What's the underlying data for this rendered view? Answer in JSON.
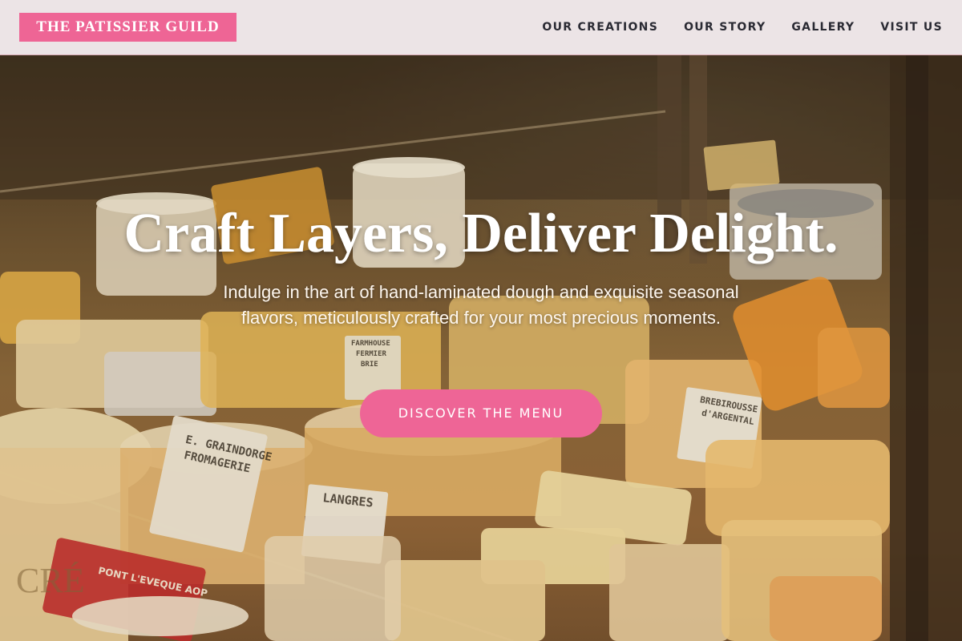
{
  "header": {
    "brand": "THE PATISSIER GUILD",
    "nav": [
      {
        "label": "OUR CREATIONS"
      },
      {
        "label": "OUR STORY"
      },
      {
        "label": "GALLERY"
      },
      {
        "label": "VISIT US"
      }
    ]
  },
  "hero": {
    "title": "Craft Layers, Deliver Delight.",
    "subtitle": "Indulge in the art of hand-laminated dough and exquisite seasonal flavors, meticulously crafted for your most precious moments.",
    "cta_label": "DISCOVER THE MENU",
    "background_image": "cheese-display-case-photo",
    "photo_labels": {
      "graindorge": [
        "E. GRAINDORGE",
        "FROMAGERIE"
      ],
      "langres": "LANGRES",
      "brebirousse": [
        "BREBIROUSSE",
        "d'ARGENTAL"
      ],
      "farmhouse": [
        "FARMHOUSE",
        "FERMIER",
        "BRIE"
      ],
      "pont_leveque": "PONT L'EVEQUE AOP",
      "cremiers": "CRÉ"
    }
  },
  "colors": {
    "brand_pink": "#ee6595",
    "header_bg": "#ece4e6",
    "nav_text": "#2a2a33",
    "hero_text": "#ffffff"
  }
}
